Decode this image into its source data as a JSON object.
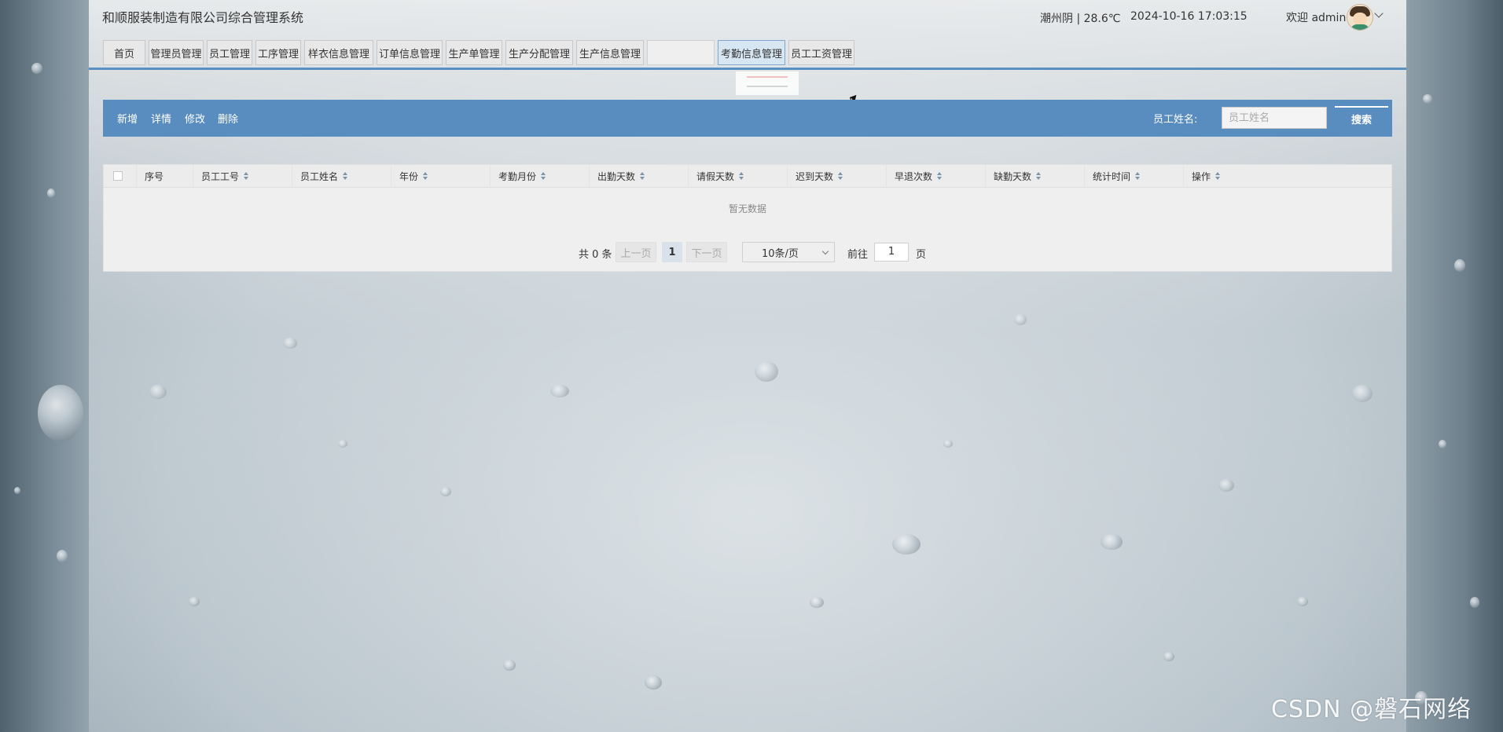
{
  "header": {
    "system_title": "和顺服装制造有限公司综合管理系统",
    "weather": "潮州阴 | 28.6℃",
    "datetime": "2024-10-16   17:03:15",
    "welcome": "欢迎 admin"
  },
  "nav": {
    "tabs": [
      {
        "label": "首页"
      },
      {
        "label": "管理员管理"
      },
      {
        "label": "员工管理"
      },
      {
        "label": "工序管理"
      },
      {
        "label": "样衣信息管理"
      },
      {
        "label": "订单信息管理"
      },
      {
        "label": "生产单管理"
      },
      {
        "label": "生产分配管理"
      },
      {
        "label": "生产信息管理"
      },
      {
        "label": ""
      },
      {
        "label": "考勤信息管理"
      },
      {
        "label": "员工工资管理"
      }
    ],
    "active_tab": "考勤信息管理"
  },
  "toolbar": {
    "add": "新增",
    "detail": "详情",
    "edit": "修改",
    "delete": "删除",
    "search_label": "员工姓名:",
    "search_placeholder": "员工姓名",
    "search_button": "搜索"
  },
  "table": {
    "columns": [
      "序号",
      "员工工号",
      "员工姓名",
      "年份",
      "考勤月份",
      "出勤天数",
      "请假天数",
      "迟到天数",
      "早退次数",
      "缺勤天数",
      "统计时间",
      "操作"
    ],
    "empty_text": "暂无数据"
  },
  "pagination": {
    "total": "共 0 条",
    "prev": "上一页",
    "current_page": "1",
    "next": "下一页",
    "page_size": "10条/页",
    "goto_label": "前往",
    "goto_value": "1",
    "page_suffix": "页"
  },
  "watermark": "CSDN @磐石网络",
  "colors": {
    "accent": "#5a8dbf",
    "nav_line": "#5a8fc2"
  }
}
